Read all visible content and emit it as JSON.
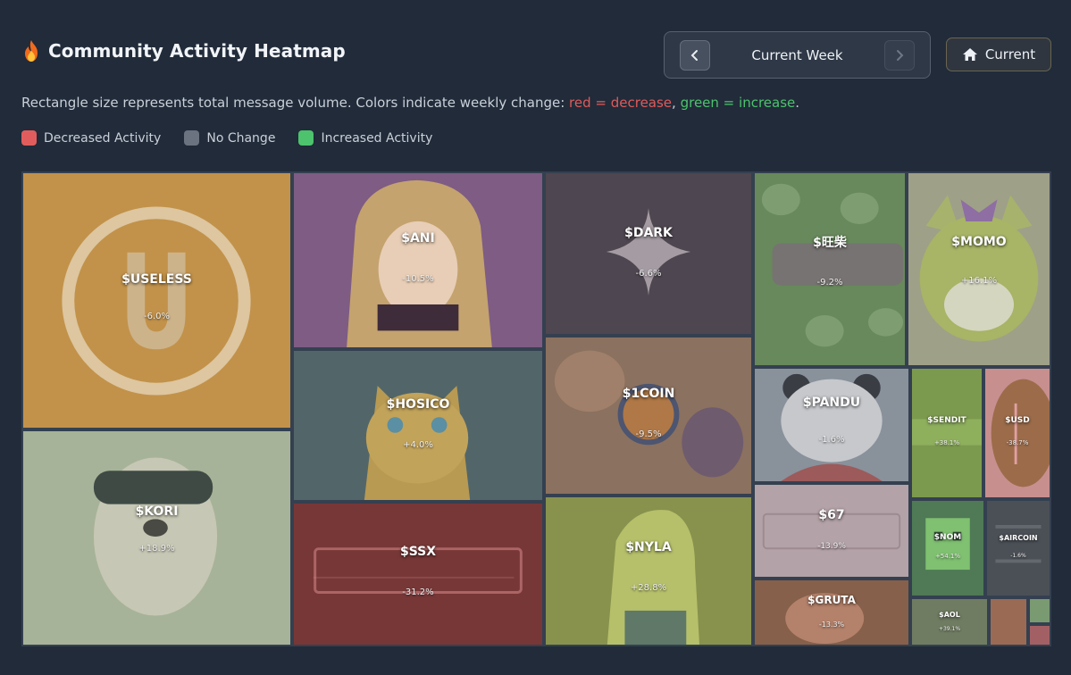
{
  "page": {
    "title": "Community Activity Heatmap",
    "title_icon": "flame-icon",
    "week_nav": {
      "label": "Current Week",
      "prev_icon": "chevron-left-icon",
      "next_icon": "chevron-right-icon"
    },
    "current_button": {
      "label": "Current",
      "icon": "home-icon"
    },
    "description": {
      "prefix": "Rectangle size represents total message volume. Colors indicate weekly change: ",
      "red_text": "red = decrease",
      "separator": ", ",
      "green_text": "green = increase",
      "suffix": "."
    },
    "legend": [
      {
        "label": "Decreased Activity",
        "color": "#e15d5d"
      },
      {
        "label": "No Change",
        "color": "#6b7280"
      },
      {
        "label": "Increased Activity",
        "color": "#4cc36c"
      }
    ]
  },
  "colors": {
    "background": "#212b39",
    "decrease": "#e05a5a",
    "increase": "#4cc36c"
  },
  "chart_data": {
    "type": "heatmap",
    "cells": [
      {
        "symbol": "$USELESS",
        "change": "-6.0%",
        "change_pct": -6.0
      },
      {
        "symbol": "$KORI",
        "change": "+18.9%",
        "change_pct": 18.9
      },
      {
        "symbol": "$ANI",
        "change": "-10.5%",
        "change_pct": -10.5
      },
      {
        "symbol": "$HOSICO",
        "change": "+4.0%",
        "change_pct": 4.0
      },
      {
        "symbol": "$SSX",
        "change": "-31.2%",
        "change_pct": -31.2
      },
      {
        "symbol": "$DARK",
        "change": "-6.6%",
        "change_pct": -6.6
      },
      {
        "symbol": "$1COIN",
        "change": "-9.5%",
        "change_pct": -9.5
      },
      {
        "symbol": "$NYLA",
        "change": "+28.8%",
        "change_pct": 28.8
      },
      {
        "symbol": "$旺柴",
        "change": "-9.2%",
        "change_pct": -9.2
      },
      {
        "symbol": "$MOMO",
        "change": "+16.1%",
        "change_pct": 16.1
      },
      {
        "symbol": "$PANDU",
        "change": "-1.6%",
        "change_pct": -1.6
      },
      {
        "symbol": "$SENDIT",
        "change": "+38.1%",
        "change_pct": 38.1
      },
      {
        "symbol": "$USD",
        "change": "-38.7%",
        "change_pct": -38.7
      },
      {
        "symbol": "$67",
        "change": "-13.9%",
        "change_pct": -13.9
      },
      {
        "symbol": "$GRUTA",
        "change": "-13.3%",
        "change_pct": -13.3
      },
      {
        "symbol": "$NOM",
        "change": "+54.1%",
        "change_pct": 54.1
      },
      {
        "symbol": "$AIRCOIN",
        "change": "-1.6%",
        "change_pct": -1.6
      },
      {
        "symbol": "$AOL",
        "change": "+39.1%",
        "change_pct": 39.1
      },
      {
        "symbol": "",
        "change": "",
        "change_pct": null
      },
      {
        "symbol": "",
        "change": "",
        "change_pct": null
      },
      {
        "symbol": "",
        "change": "",
        "change_pct": null
      }
    ]
  }
}
